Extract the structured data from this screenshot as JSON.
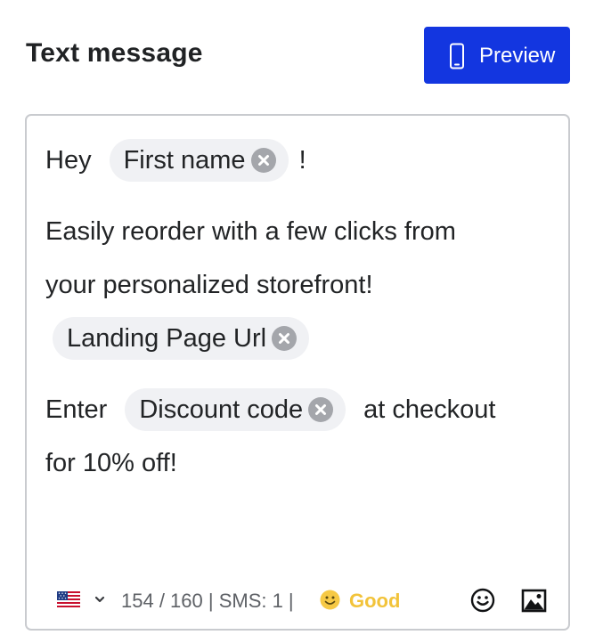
{
  "header": {
    "title": "Text message",
    "preview_label": "Preview"
  },
  "message": {
    "line1_before": "Hey",
    "line1_after": "!",
    "line2": "Easily reorder with a few clicks from",
    "line3": "your personalized storefront!",
    "line5_before": "Enter",
    "line5_after": "at checkout",
    "line6": "for 10% off!",
    "tokens": {
      "first_name": "First name",
      "landing_page_url": "Landing Page Url",
      "discount_code": "Discount code"
    }
  },
  "footer": {
    "country_flag": "us-flag-icon",
    "char_count": "154 / 160 | SMS: 1 |",
    "quality_label": "Good",
    "quality_color": "#f2c33a"
  },
  "colors": {
    "primary": "#1336e0",
    "chip_bg": "#f0f1f4",
    "chip_remove": "#a4a6ab",
    "border": "#c9cbcf"
  }
}
